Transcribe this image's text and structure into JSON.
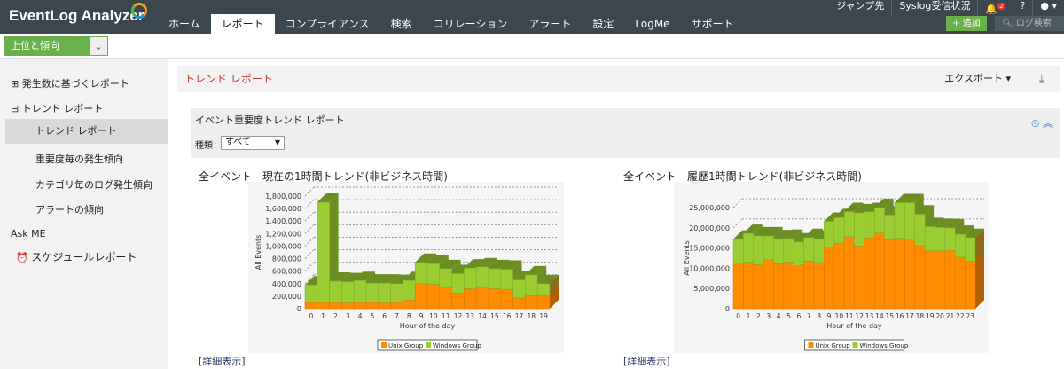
{
  "app": {
    "logo": "EventLog Analyzer"
  },
  "nav": [
    "ホーム",
    "レポート",
    "コンプライアンス",
    "検索",
    "コリレーション",
    "アラート",
    "設定",
    "LogMe",
    "サポート"
  ],
  "util": {
    "jump": "ジャンプ先",
    "syslog": "Syslog受信状況",
    "notif_count": "2",
    "help": "?",
    "add": "+ 追加",
    "search_placeholder": "ログ検索"
  },
  "subbar": {
    "dropdown": "上位と傾向"
  },
  "sidebar": {
    "items": [
      "発生数に基づくレポート",
      "トレンド レポート",
      "トレンド レポート",
      "重要度毎の発生傾向",
      "カテゴリ毎のログ発生傾向",
      "アラートの傾向",
      "Ask ME",
      "スケジュールレポート"
    ]
  },
  "main": {
    "title": "トレンド レポート",
    "export": "エクスポート ▾",
    "panel_title": "イベント重要度トレンド レポート",
    "kind_label": "種類：",
    "kind_value": "すべて"
  },
  "detail_link": "[詳細表示]",
  "colors": {
    "unix": "#ff8c00",
    "windows": "#9acd32",
    "windows_top": "#6b8e23"
  },
  "chart_data": [
    {
      "type": "bar",
      "stacked": true,
      "title": "全イベント - 現在の1時間トレンド(非ビジネス時間)",
      "xlabel": "Hour of the day",
      "ylabel": "All Events",
      "ylim": [
        0,
        1800000
      ],
      "yticks": [
        "0",
        "200,000",
        "400,000",
        "600,000",
        "800,000",
        "1,000,000",
        "1,200,000",
        "1,400,000",
        "1,600,000",
        "1,800,000"
      ],
      "categories": [
        "0",
        "1",
        "2",
        "3",
        "4",
        "5",
        "6",
        "7",
        "8",
        "9",
        "10",
        "11",
        "12",
        "13",
        "14",
        "15",
        "16",
        "17",
        "18",
        "19"
      ],
      "series": [
        {
          "name": "Unix Group",
          "values": [
            100000,
            100000,
            100000,
            95000,
            100000,
            100000,
            95000,
            100000,
            140000,
            400000,
            390000,
            330000,
            250000,
            320000,
            330000,
            320000,
            310000,
            170000,
            210000,
            210000
          ]
        },
        {
          "name": "Windows Group",
          "values": [
            280000,
            1600000,
            340000,
            335000,
            350000,
            310000,
            315000,
            300000,
            310000,
            340000,
            330000,
            310000,
            310000,
            330000,
            340000,
            320000,
            320000,
            290000,
            330000,
            190000
          ]
        }
      ]
    },
    {
      "type": "bar",
      "stacked": true,
      "title": "全イベント - 履歴1時間トレンド(非ビジネス時間)",
      "xlabel": "Hour of the day",
      "ylabel": "All Events",
      "ylim": [
        0,
        25000000
      ],
      "yticks": [
        "0",
        "5,000,000",
        "10,000,000",
        "15,000,000",
        "20,000,000",
        "25,000,000"
      ],
      "categories": [
        "0",
        "1",
        "2",
        "3",
        "4",
        "5",
        "6",
        "7",
        "8",
        "9",
        "10",
        "11",
        "12",
        "13",
        "14",
        "15",
        "16",
        "17",
        "18",
        "19",
        "20",
        "21",
        "22",
        "23"
      ],
      "series": [
        {
          "name": "Unix Group",
          "values": [
            11300000,
            11500000,
            10900000,
            12100000,
            11100000,
            11500000,
            10600000,
            11800000,
            11400000,
            15200000,
            16200000,
            17800000,
            15500000,
            17500000,
            18700000,
            17000000,
            17400000,
            17200000,
            15600000,
            14300000,
            14300000,
            14400000,
            12700000,
            11700000
          ]
        },
        {
          "name": "Windows Group",
          "values": [
            5900000,
            7100000,
            7100000,
            5900000,
            6200000,
            5900000,
            5900000,
            5800000,
            5800000,
            6400000,
            6300000,
            6200000,
            8200000,
            6500000,
            6300000,
            6200000,
            8800000,
            9000000,
            7800000,
            6000000,
            5800000,
            5600000,
            5700000,
            5900000
          ]
        }
      ]
    }
  ]
}
